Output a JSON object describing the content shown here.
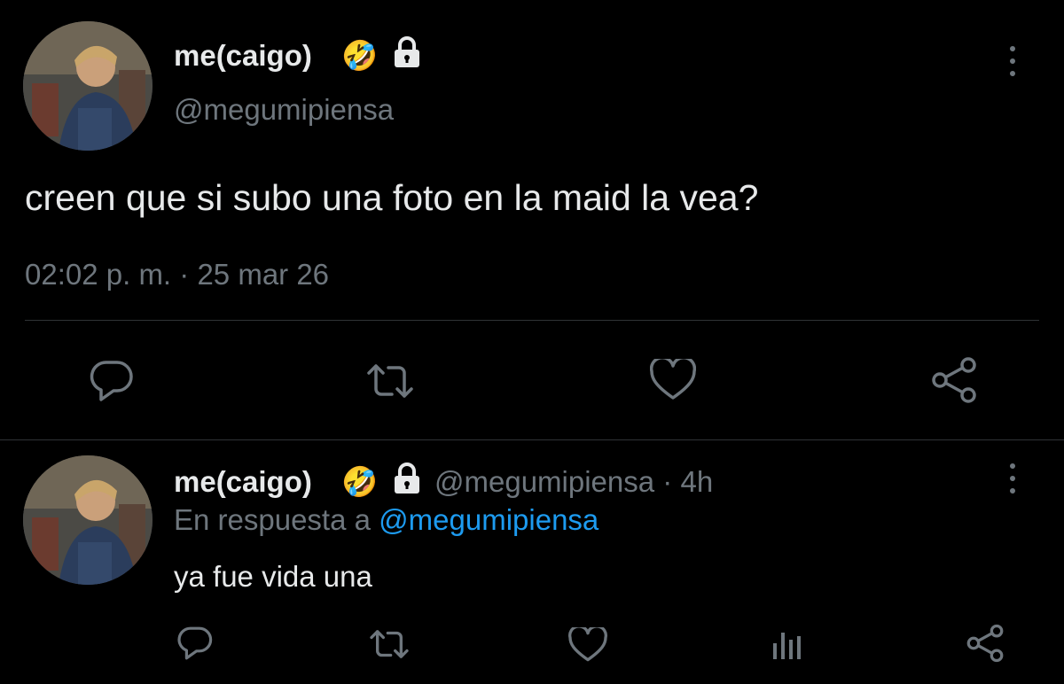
{
  "main_tweet": {
    "display_name": "me(caigo)",
    "emoji": "🤣",
    "handle": "@megumipiensa",
    "text": "creen que si subo una foto en la maid la vea?",
    "time": "02:02 p. m.",
    "separator": "·",
    "date": "25 mar 26",
    "actions": [
      "reply-icon",
      "retweet-icon",
      "like-icon",
      "share-icon"
    ]
  },
  "reply_tweet": {
    "display_name": "me(caigo)",
    "emoji": "🤣",
    "handle": "@megumipiensa",
    "separator": "·",
    "age": "4h",
    "in_reply_prefix": "En respuesta a",
    "in_reply_handle": "@megumipiensa",
    "text": "ya fue vida una",
    "actions": [
      "reply-icon",
      "retweet-icon",
      "like-icon",
      "analytics-icon",
      "share-icon"
    ]
  },
  "colors": {
    "background": "#000000",
    "text": "#e7e9ea",
    "muted": "#6e767d",
    "link": "#1d9bf0",
    "divider": "#2f3336"
  }
}
